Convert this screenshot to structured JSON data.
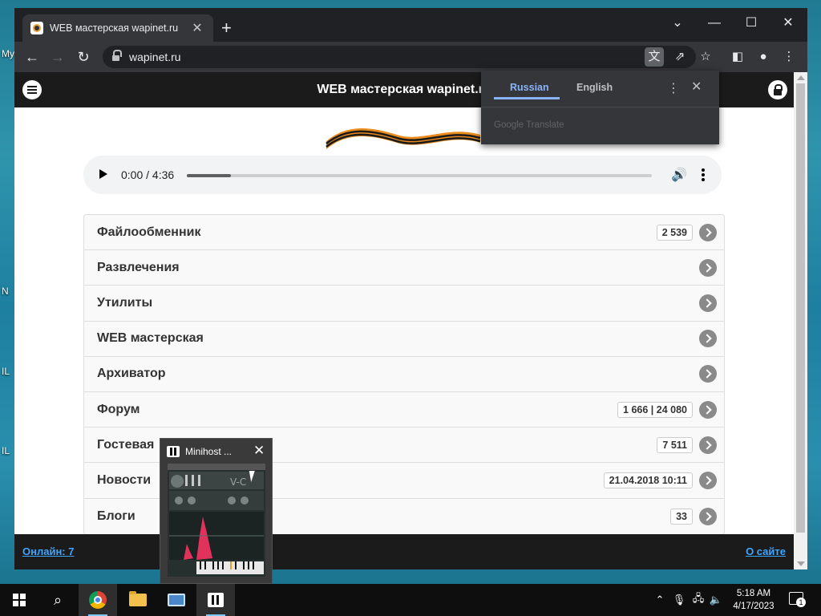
{
  "desktop": {
    "edge_labels": [
      "My",
      "N",
      "IL",
      "IL"
    ]
  },
  "browser": {
    "tab_title": "WEB мастерская wapinet.ru",
    "url": "wapinet.ru",
    "window_controls": {
      "minimize": "—",
      "maximize": "☐",
      "close": "✕"
    }
  },
  "site": {
    "title": "WEB мастерская wapinet.ru",
    "audio": {
      "time": "0:00 / 4:36",
      "progress": 0.0
    },
    "menu": [
      {
        "label": "Файлообменник",
        "count": "2 539"
      },
      {
        "label": "Развлечения",
        "count": ""
      },
      {
        "label": "Утилиты",
        "count": ""
      },
      {
        "label": "WEB мастерская",
        "count": ""
      },
      {
        "label": "Архиватор",
        "count": ""
      },
      {
        "label": "Форум",
        "count": "1 666 | 24 080"
      },
      {
        "label": "Гостевая",
        "count": "7 511"
      },
      {
        "label": "Новости",
        "count": "21.04.2018 10:11"
      },
      {
        "label": "Блоги",
        "count": "33"
      }
    ],
    "footer": {
      "online": "Онлайн: 7",
      "about": "О сайте"
    }
  },
  "translate_popup": {
    "lang_active": "Russian",
    "lang_other": "English",
    "brand": "Google Translate",
    "accent": "#8ab4f8"
  },
  "taskbar_preview": {
    "title": "Minihost ..."
  },
  "taskbar": {
    "time": "5:18 AM",
    "date": "4/17/2023",
    "notifications": "1"
  }
}
